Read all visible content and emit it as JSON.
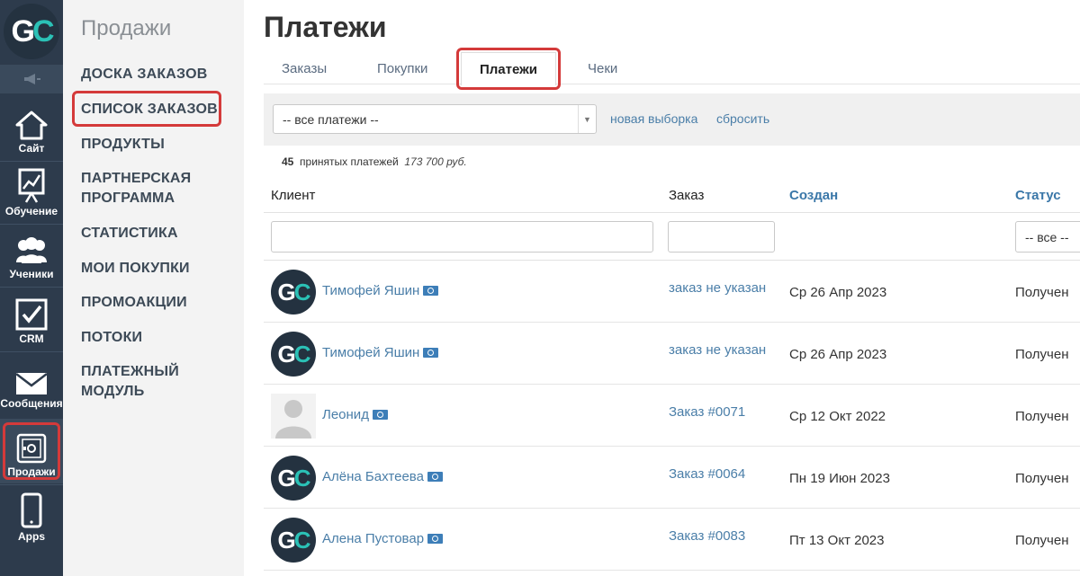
{
  "rail": {
    "logo": {
      "g": "G",
      "c": "C"
    },
    "items": [
      {
        "label": "Сайт",
        "icon": "house-icon"
      },
      {
        "label": "Обучение",
        "icon": "chart-board-icon"
      },
      {
        "label": "Ученики",
        "icon": "users-icon"
      },
      {
        "label": "CRM",
        "icon": "checkbox-icon"
      },
      {
        "label": "Сообщения",
        "icon": "envelope-icon"
      },
      {
        "label": "Продажи",
        "icon": "safe-icon"
      },
      {
        "label": "Apps",
        "icon": "phone-icon"
      }
    ]
  },
  "subnav": {
    "title": "Продажи",
    "items": [
      "ДОСКА ЗАКАЗОВ",
      "СПИСОК ЗАКАЗОВ",
      "ПРОДУКТЫ",
      "ПАРТНЕРСКАЯ ПРОГРАММА",
      "СТАТИСТИКА",
      "МОИ ПОКУПКИ",
      "ПРОМОАКЦИИ",
      "ПОТОКИ",
      "ПЛАТЕЖНЫЙ МОДУЛЬ"
    ]
  },
  "page": {
    "title": "Платежи",
    "tabs": [
      "Заказы",
      "Покупки",
      "Платежи",
      "Чеки"
    ],
    "active_tab": "Платежи"
  },
  "filter": {
    "select_value": "-- все платежи --",
    "new_selection": "новая выборка",
    "reset": "сбросить"
  },
  "summary": {
    "count": "45",
    "text": "принятых платежей",
    "amount": "173 700 руб."
  },
  "table": {
    "headers": {
      "client": "Клиент",
      "order": "Заказ",
      "created": "Создан",
      "status": "Статус"
    },
    "status_filter": "-- все --",
    "rows": [
      {
        "avatar": "gc",
        "client": "Тимофей Яшин",
        "order": "заказ не указан",
        "created": "Ср 26 Апр 2023",
        "status": "Получен"
      },
      {
        "avatar": "gc",
        "client": "Тимофей Яшин",
        "order": "заказ не указан",
        "created": "Ср 26 Апр 2023",
        "status": "Получен"
      },
      {
        "avatar": "person",
        "client": "Леонид",
        "order": "Заказ #0071",
        "created": "Ср 12 Окт 2022",
        "status": "Получен"
      },
      {
        "avatar": "gc",
        "client": "Алёна Бахтеева",
        "order": "Заказ #0064",
        "created": "Пн 19 Июн 2023",
        "status": "Получен"
      },
      {
        "avatar": "gc",
        "client": "Алена Пустовар",
        "order": "Заказ #0083",
        "created": "Пт 13 Окт 2023",
        "status": "Получен"
      }
    ]
  },
  "colors": {
    "highlight": "#d43a3a",
    "link": "#4a7ea8",
    "rail": "#2d3b4c",
    "brand_accent": "#2bc1b6"
  }
}
